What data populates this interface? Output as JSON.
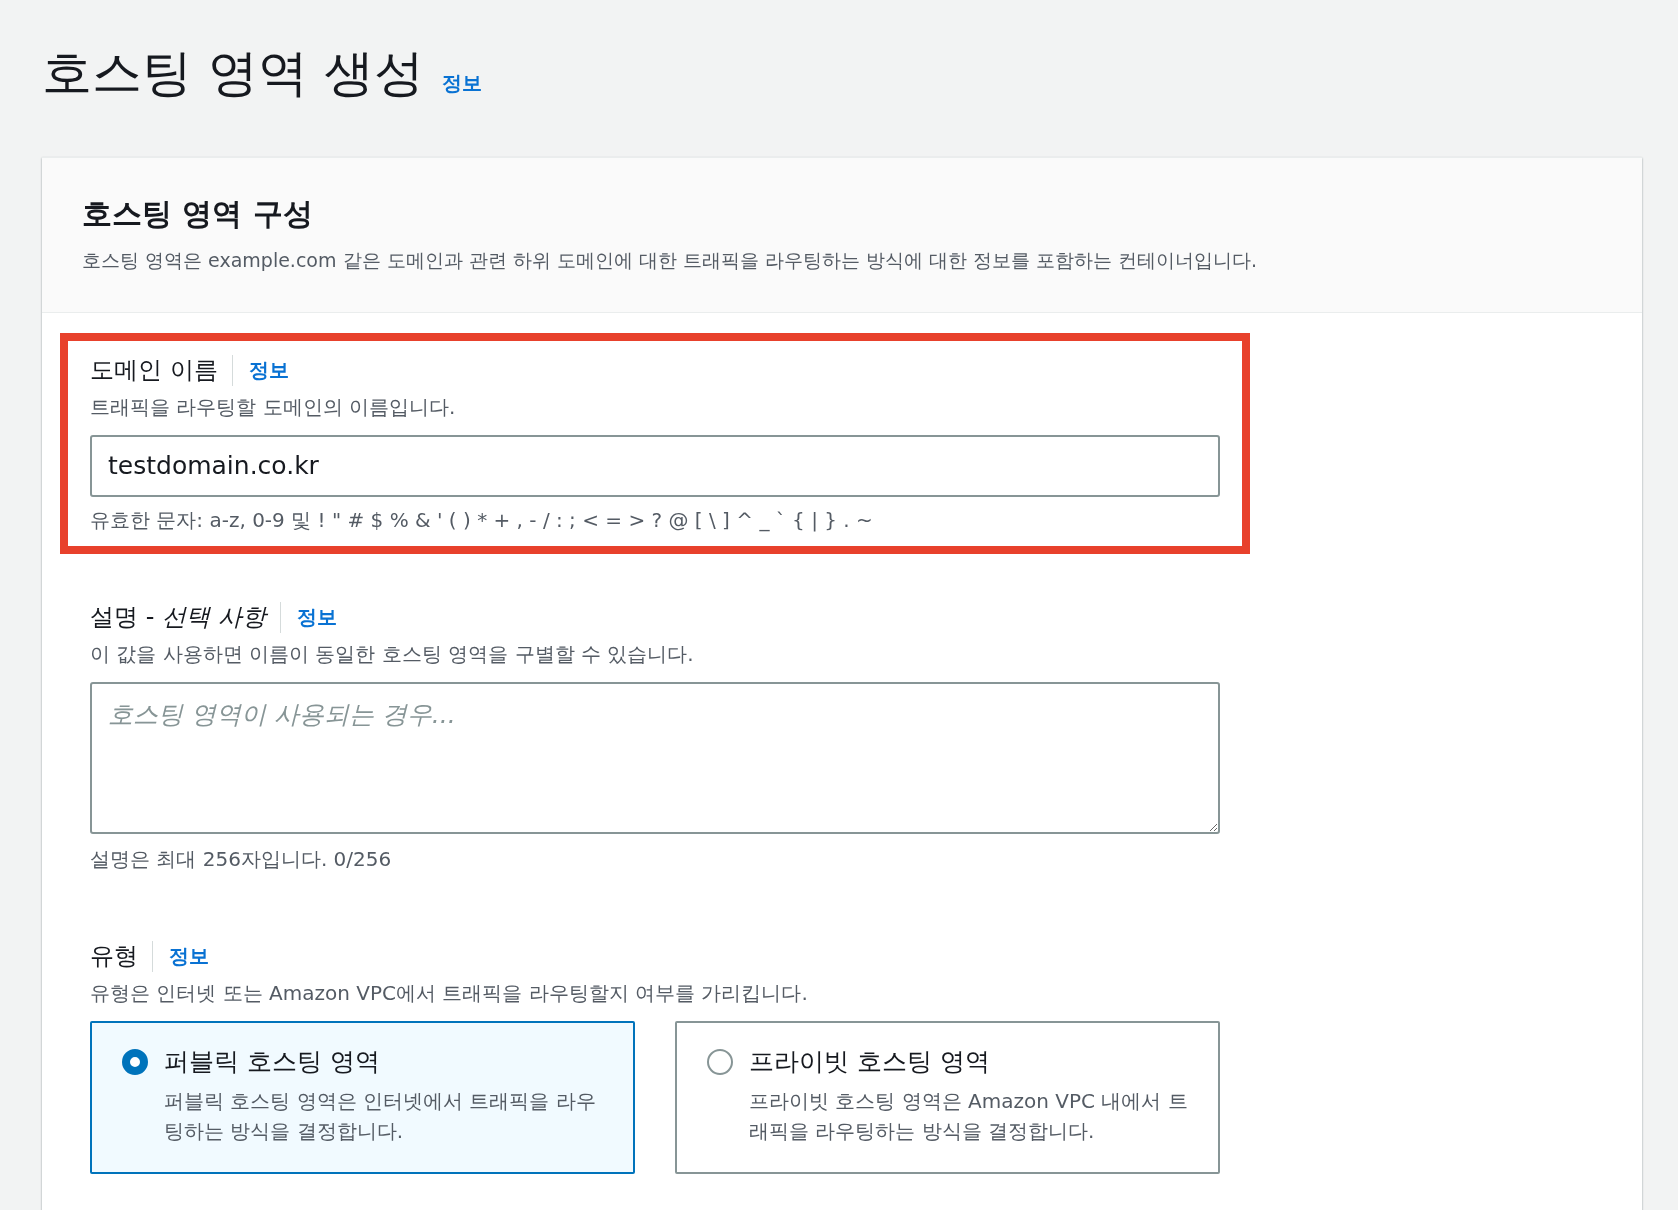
{
  "page": {
    "title": "호스팅 영역 생성",
    "info_link": "정보"
  },
  "card": {
    "title": "호스팅 영역 구성",
    "description": "호스팅 영역은 example.com 같은 도메인과 관련 하위 도메인에 대한 트래픽을 라우팅하는 방식에 대한 정보를 포함하는 컨테이너입니다."
  },
  "domain_field": {
    "label": "도메인 이름",
    "info_link": "정보",
    "description": "트래픽을 라우팅할 도메인의 이름입니다.",
    "value": "testdomain.co.kr",
    "constraint": "유효한 문자: a-z, 0-9 및 ! \" # $ % & ' ( ) * + , - / : ; < = > ? @ [ \\ ] ^ _ ` { | } . ~",
    "highlighted": true
  },
  "description_field": {
    "label": "설명 - *선택 사항*",
    "info_link": "정보",
    "description": "이 값을 사용하면 이름이 동일한 호스팅 영역을 구별할 수 있습니다.",
    "placeholder": "호스팅 영역이 사용되는 경우...",
    "constraint": "설명은 최대 256자입니다. 0/256"
  },
  "type_field": {
    "label": "유형",
    "info_link": "정보",
    "description": "유형은 인터넷 또는 Amazon VPC에서 트래픽을 라우팅할지 여부를 가리킵니다.",
    "options": [
      {
        "label": "퍼블릭 호스팅 영역",
        "description": "퍼블릭 호스팅 영역은 인터넷에서 트래픽을 라우팅하는 방식을 결정합니다.",
        "selected": true
      },
      {
        "label": "프라이빗 호스팅 영역",
        "description": "프라이빗 호스팅 영역은 Amazon VPC 내에서 트래픽을 라우팅하는 방식을 결정합니다.",
        "selected": false
      }
    ]
  }
}
